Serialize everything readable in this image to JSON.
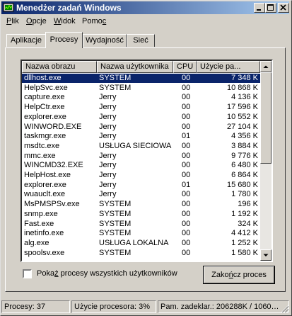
{
  "window": {
    "title": "Menedżer zadań Windows"
  },
  "menu": [
    {
      "pre": "",
      "acc": "P",
      "post": "lik"
    },
    {
      "pre": "",
      "acc": "O",
      "post": "pcje"
    },
    {
      "pre": "",
      "acc": "W",
      "post": "idok"
    },
    {
      "pre": "Pomo",
      "acc": "c",
      "post": ""
    }
  ],
  "tabs": [
    "Aplikacje",
    "Procesy",
    "Wydajność",
    "Sieć"
  ],
  "active_tab": 1,
  "columns": [
    "Nazwa obrazu",
    "Nazwa użytkownika",
    "CPU",
    "Użycie pa..."
  ],
  "processes": [
    [
      "dllhost.exe",
      "SYSTEM",
      "00",
      "7 348 K"
    ],
    [
      "HelpSvc.exe",
      "SYSTEM",
      "00",
      "10 868 K"
    ],
    [
      "capture.exe",
      "Jerry",
      "00",
      "4 136 K"
    ],
    [
      "HelpCtr.exe",
      "Jerry",
      "00",
      "17 596 K"
    ],
    [
      "explorer.exe",
      "Jerry",
      "00",
      "10 552 K"
    ],
    [
      "WINWORD.EXE",
      "Jerry",
      "00",
      "27 104 K"
    ],
    [
      "taskmgr.exe",
      "Jerry",
      "01",
      "4 356 K"
    ],
    [
      "msdtc.exe",
      "USŁUGA SIECIOWA",
      "00",
      "3 884 K"
    ],
    [
      "mmc.exe",
      "Jerry",
      "00",
      "9 776 K"
    ],
    [
      "WINCMD32.EXE",
      "Jerry",
      "00",
      "6 480 K"
    ],
    [
      "HelpHost.exe",
      "Jerry",
      "00",
      "6 864 K"
    ],
    [
      "explorer.exe",
      "Jerry",
      "01",
      "15 680 K"
    ],
    [
      "wuauclt.exe",
      "Jerry",
      "00",
      "1 780 K"
    ],
    [
      "MsPMSPSv.exe",
      "SYSTEM",
      "00",
      "196 K"
    ],
    [
      "snmp.exe",
      "SYSTEM",
      "00",
      "1 192 K"
    ],
    [
      "Fast.exe",
      "SYSTEM",
      "00",
      "324 K"
    ],
    [
      "inetinfo.exe",
      "SYSTEM",
      "00",
      "4 412 K"
    ],
    [
      "alg.exe",
      "USŁUGA LOKALNA",
      "00",
      "1 252 K"
    ],
    [
      "spoolsv.exe",
      "SYSTEM",
      "00",
      "1 580 K"
    ]
  ],
  "selected_row": 0,
  "show_all": {
    "pre": "Poka",
    "acc": "ż",
    "post": " procesy wszystkich użytkowników",
    "checked": false
  },
  "end_button": {
    "pre": "Zako",
    "acc": "ń",
    "post": "cz proces"
  },
  "status": {
    "processes": "Procesy: 37",
    "cpu": "Użycie procesora: 3%",
    "mem": "Pam. zadeklar.: 206288K / 1060…"
  },
  "colors": {
    "title_start": "#0a246a",
    "title_end": "#a6caf0",
    "selection": "#0a246a",
    "face": "#d4d0c8"
  }
}
